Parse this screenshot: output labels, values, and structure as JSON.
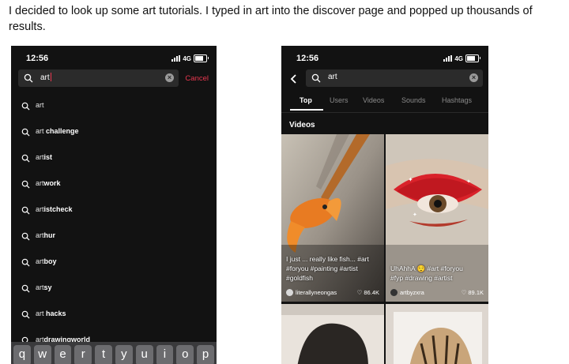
{
  "caption": "I decided to look up some art tutorials. I typed in art into the discover page and popped up thousands of results.",
  "left_phone": {
    "time": "12:56",
    "network": "4G",
    "search": {
      "query": "art",
      "cancel_label": "Cancel"
    },
    "suggestions": [
      {
        "prefix": "art",
        "suffix": ""
      },
      {
        "prefix": "art",
        "suffix": " challenge"
      },
      {
        "prefix": "art",
        "suffix": "ist"
      },
      {
        "prefix": "art",
        "suffix": "work"
      },
      {
        "prefix": "art",
        "suffix": "istcheck"
      },
      {
        "prefix": "art",
        "suffix": "hur"
      },
      {
        "prefix": "art",
        "suffix": "boy"
      },
      {
        "prefix": "art",
        "suffix": "sy"
      },
      {
        "prefix": "art",
        "suffix": " hacks"
      },
      {
        "prefix": "art",
        "suffix": "drawingworld"
      }
    ],
    "keyboard": [
      "q",
      "w",
      "e",
      "r",
      "t",
      "y",
      "u",
      "i",
      "o",
      "p"
    ]
  },
  "right_phone": {
    "time": "12:56",
    "network": "4G",
    "search": {
      "query": "art"
    },
    "tabs": [
      "Top",
      "Users",
      "Videos",
      "Sounds",
      "Hashtags"
    ],
    "section_title": "Videos",
    "videos": [
      {
        "caption_line1": "I just ... really like fish... #art",
        "caption_line2": "#foryou #painting #artist",
        "caption_line3": "#goldfish",
        "user": "literallyneongas",
        "likes": "86.4K"
      },
      {
        "caption_line1": "UhAhhA 😌 #art #foryou",
        "caption_line2": "#fyp #drawing #artist",
        "caption_line3": "",
        "user": "artbyzxra",
        "likes": "89.1K"
      }
    ]
  },
  "colors": {
    "accent": "#e8374f",
    "background": "#121212",
    "search_bg": "#2b2b2b"
  }
}
